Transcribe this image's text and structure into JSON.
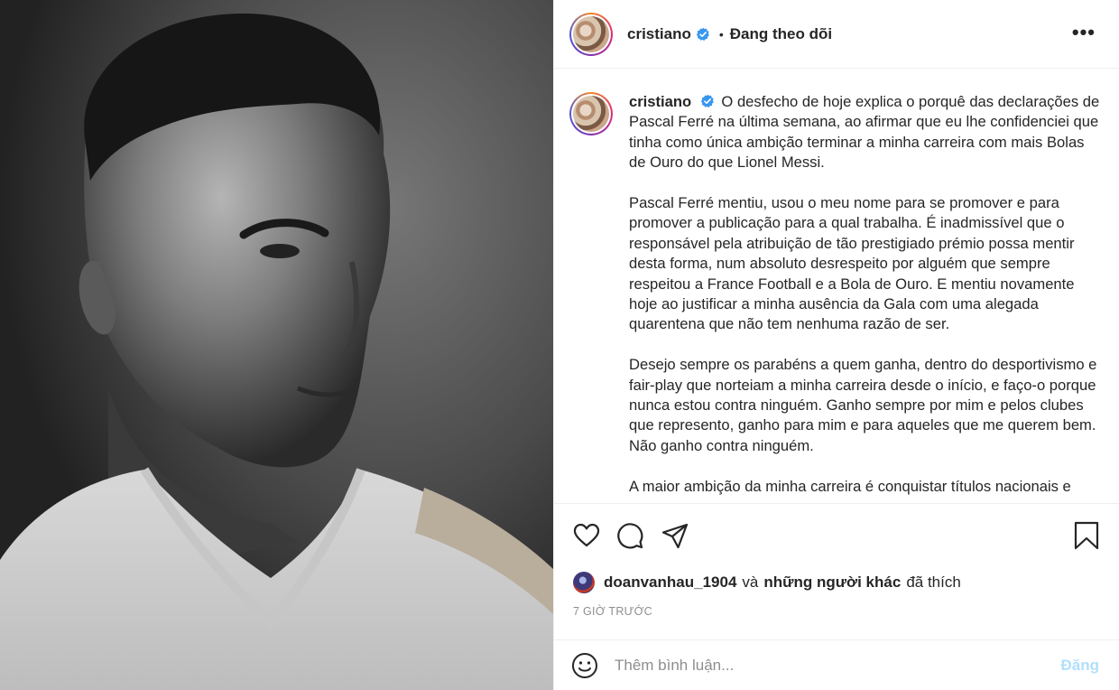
{
  "header": {
    "username": "cristiano",
    "separator": "•",
    "follow_state": "Đang theo dõi",
    "more": "•••"
  },
  "caption": {
    "username": "cristiano",
    "paragraphs": [
      "O desfecho de hoje explica o porquê das declarações de Pascal Ferré na última semana, ao afirmar que eu lhe confidenciei que tinha como única ambição terminar a minha carreira com mais Bolas de Ouro do que Lionel Messi.",
      "Pascal Ferré mentiu, usou o meu nome para se promover e para promover a publicação para a qual trabalha. É inadmissível que o responsável pela atribuição de tão prestigiado prémio possa mentir desta forma, num absoluto desrespeito por alguém que sempre respeitou a France Football e a Bola de Ouro. E mentiu novamente hoje ao justificar a minha ausência da Gala com uma alegada quarentena que não tem nenhuma razão de ser.",
      "Desejo sempre os parabéns a quem ganha, dentro do desportivismo e fair-play que norteiam a minha carreira desde o início, e faço-o porque nunca estou contra ninguém. Ganho sempre por mim e pelos clubes que represento, ganho para mim e para aqueles que me querem bem. Não ganho contra ninguém.",
      "A maior ambição da minha carreira é conquistar títulos nacionais e"
    ]
  },
  "likes": {
    "liker": "doanvanhau_1904",
    "conjunction": "và",
    "others": "những người khác",
    "suffix": "đã thích"
  },
  "time": "7 GIỜ TRƯỚC",
  "comment": {
    "placeholder": "Thêm bình luận...",
    "post_label": "Đăng"
  },
  "icons": {
    "like": "heart-icon",
    "comment": "comment-icon",
    "share": "share-icon",
    "save": "bookmark-icon",
    "emoji": "emoji-icon",
    "verified": "verified-badge-icon"
  },
  "colors": {
    "verified": "#3897f0",
    "post_button_disabled": "#b2dffc",
    "muted_text": "#8e8e8e",
    "border": "#efefef"
  }
}
